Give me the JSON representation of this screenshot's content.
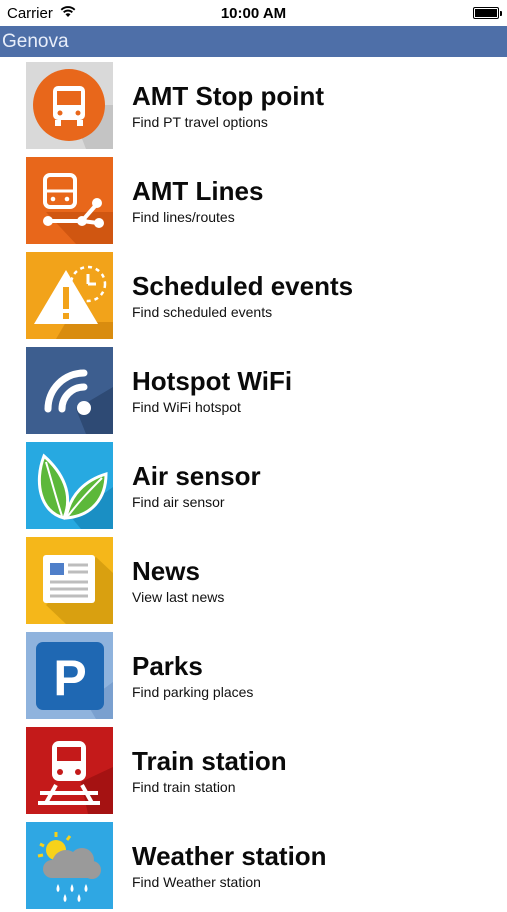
{
  "status_bar": {
    "carrier": "Carrier",
    "time": "10:00 AM"
  },
  "nav": {
    "title": "Genova"
  },
  "items": [
    {
      "title": "AMT Stop point",
      "subtitle": "Find PT travel options",
      "icon": "bus-stop-icon",
      "color": "#e8671b"
    },
    {
      "title": "AMT Lines",
      "subtitle": "Find lines/routes",
      "icon": "bus-lines-icon",
      "color": "#e8671b"
    },
    {
      "title": "Scheduled events",
      "subtitle": "Find scheduled events",
      "icon": "warning-clock-icon",
      "color": "#f2a31a"
    },
    {
      "title": "Hotspot WiFi",
      "subtitle": "Find WiFi hotspot",
      "icon": "wifi-icon",
      "color": "#3d5e8f"
    },
    {
      "title": "Air sensor",
      "subtitle": "Find air sensor",
      "icon": "leaf-icon",
      "color": "#27a9e1"
    },
    {
      "title": "News",
      "subtitle": "View last news",
      "icon": "newspaper-icon",
      "color": "#f5b71a"
    },
    {
      "title": "Parks",
      "subtitle": "Find parking places",
      "icon": "parking-icon",
      "color": "#8fb3dd"
    },
    {
      "title": "Train station",
      "subtitle": "Find train station",
      "icon": "train-icon",
      "color": "#c41a1a"
    },
    {
      "title": "Weather station",
      "subtitle": "Find Weather station",
      "icon": "weather-icon",
      "color": "#2fa7e3"
    }
  ]
}
